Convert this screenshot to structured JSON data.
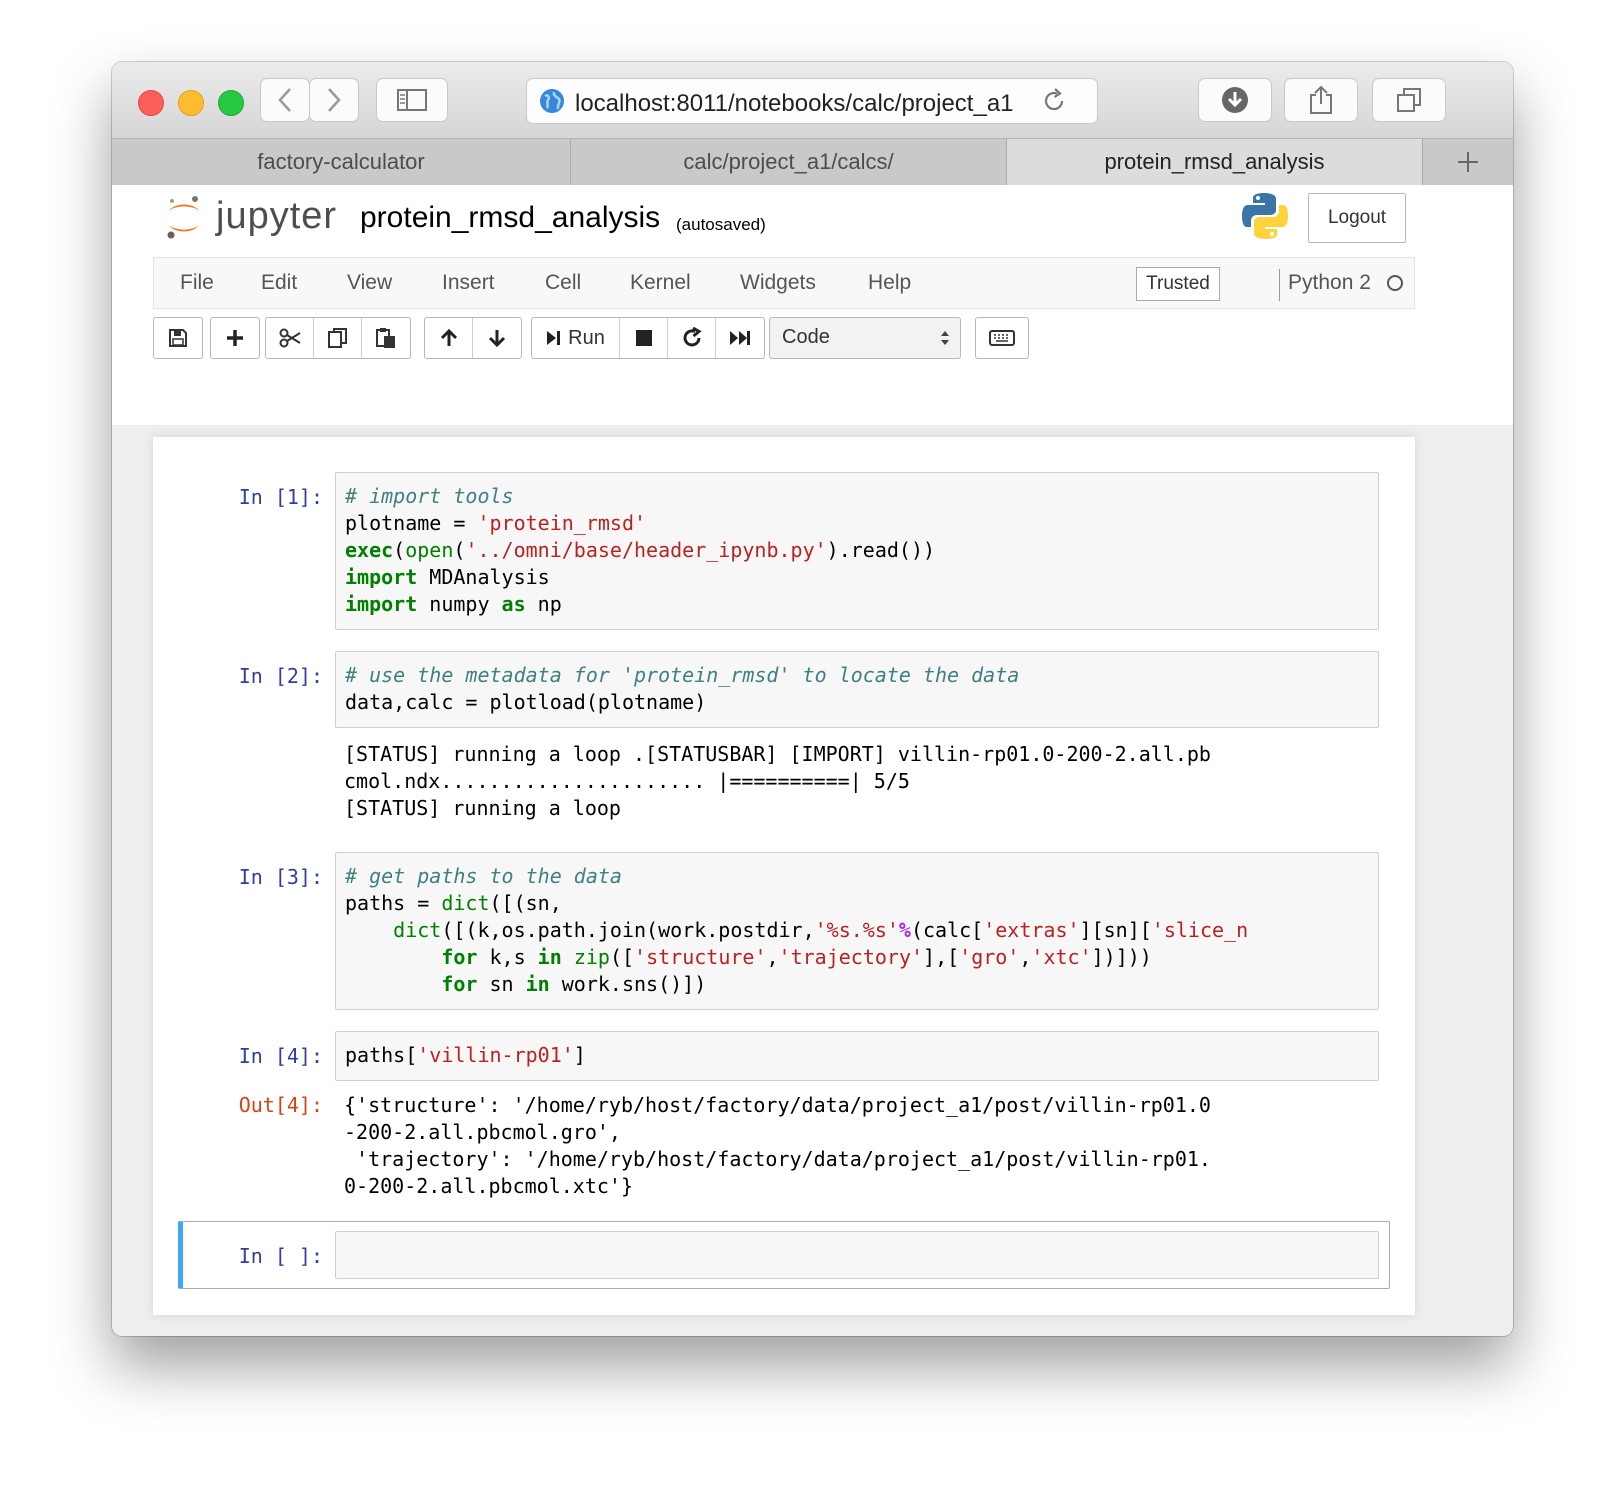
{
  "browser": {
    "url": "localhost:8011/notebooks/calc/project_a1",
    "tabs": [
      {
        "label": "factory-calculator"
      },
      {
        "label": "calc/project_a1/calcs/"
      },
      {
        "label": "protein_rmsd_analysis"
      }
    ]
  },
  "header": {
    "logo_text": "jupyter",
    "notebook_name": "protein_rmsd_analysis",
    "autosave": "(autosaved)",
    "logout_label": "Logout"
  },
  "menubar": {
    "items": [
      "File",
      "Edit",
      "View",
      "Insert",
      "Cell",
      "Kernel",
      "Widgets",
      "Help"
    ],
    "trusted_label": "Trusted",
    "kernel_name": "Python 2"
  },
  "toolbar": {
    "run_label": "Run",
    "cell_type": "Code"
  },
  "cells": [
    {
      "prompt": "In [1]:",
      "source_lines": [
        "# import tools",
        "plotname = 'protein_rmsd'",
        "exec(open('../omni/base/header_ipynb.py').read())",
        "import MDAnalysis",
        "import numpy as np"
      ]
    },
    {
      "prompt": "In [2]:",
      "source_lines": [
        "# use the metadata for 'protein_rmsd' to locate the data",
        "data,calc = plotload(plotname)"
      ],
      "output": "[STATUS] running a loop .[STATUSBAR] [IMPORT] villin-rp01.0-200-2.all.pb\ncmol.ndx...................... |==========| 5/5\n[STATUS] running a loop"
    },
    {
      "prompt": "In [3]:",
      "source_lines": [
        "# get paths to the data",
        "paths = dict([(sn,",
        "    dict([(k,os.path.join(work.postdir,'%s.%s'%(calc['extras'][sn]['slice_n",
        "        for k,s in zip(['structure','trajectory'],['gro','xtc'])]))",
        "        for sn in work.sns()])"
      ]
    },
    {
      "prompt": "In [4]:",
      "source_lines": [
        "paths['villin-rp01']"
      ],
      "out_prompt": "Out[4]:",
      "output": "{'structure': '/home/ryb/host/factory/data/project_a1/post/villin-rp01.0\n-200-2.all.pbcmol.gro',\n 'trajectory': '/home/ryb/host/factory/data/project_a1/post/villin-rp01.\n0-200-2.all.pbcmol.xtc'}"
    },
    {
      "prompt": "In [ ]:",
      "source_lines": []
    }
  ],
  "icons": [
    "back-icon",
    "forward-icon",
    "sidebar-icon",
    "globe-icon",
    "reload-icon",
    "download-icon",
    "share-icon",
    "tabs-icon",
    "new-tab-icon",
    "python-logo",
    "save-icon",
    "plus-icon",
    "cut-icon",
    "copy-icon",
    "paste-icon",
    "move-up-icon",
    "move-down-icon",
    "run-icon",
    "stop-icon",
    "restart-icon",
    "fast-forward-icon",
    "keyboard-icon"
  ],
  "colors": {
    "jupyter_orange": "#f37726",
    "prompt_in": "#303f9f",
    "prompt_out": "#d84315",
    "selected_cell_accent": "#42a5f5"
  }
}
